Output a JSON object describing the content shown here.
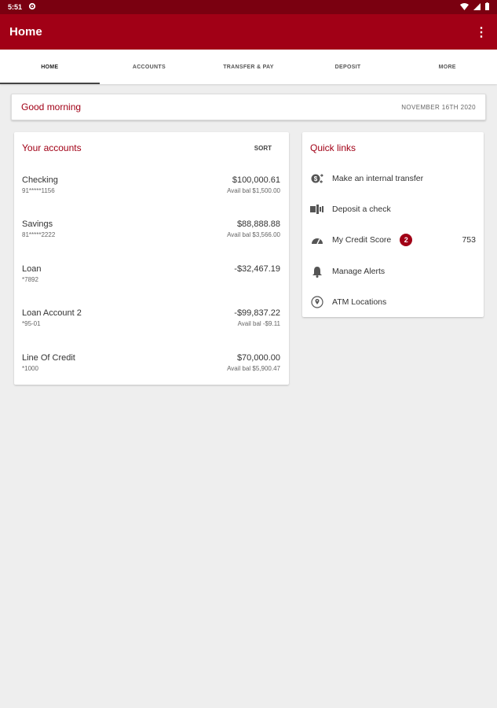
{
  "status": {
    "time": "5:51"
  },
  "appbar": {
    "title": "Home",
    "menu": "⋮"
  },
  "tabs": [
    {
      "label": "HOME",
      "active": true
    },
    {
      "label": "ACCOUNTS"
    },
    {
      "label": "TRANSFER & PAY"
    },
    {
      "label": "DEPOSIT"
    },
    {
      "label": "MORE"
    }
  ],
  "greeting": {
    "text": "Good morning",
    "date": "NOVEMBER 16TH 2020"
  },
  "accounts": {
    "title": "Your accounts",
    "sort_label": "SORT",
    "items": [
      {
        "name": "Checking",
        "number": "91*****1156",
        "balance": "$100,000.61",
        "avail": "Avail bal $1,500.00"
      },
      {
        "name": "Savings",
        "number": "81*****2222",
        "balance": "$88,888.88",
        "avail": "Avail bal $3,566.00"
      },
      {
        "name": "Loan",
        "number": "*7892",
        "balance": "-$32,467.19",
        "avail": ""
      },
      {
        "name": "Loan Account 2",
        "number": "*95-01",
        "balance": "-$99,837.22",
        "avail": "Avail bal -$9.11"
      },
      {
        "name": "Line Of Credit",
        "number": "*1000",
        "balance": "$70,000.00",
        "avail": "Avail bal $5,900.47"
      }
    ]
  },
  "quick_links": {
    "title": "Quick links",
    "items": [
      {
        "label": "Make an internal transfer",
        "icon": "transfer-icon"
      },
      {
        "label": "Deposit a check",
        "icon": "check-deposit-icon"
      },
      {
        "label": "My Credit Score",
        "icon": "gauge-icon",
        "badge": "2",
        "score": "753"
      },
      {
        "label": "Manage Alerts",
        "icon": "bell-icon"
      },
      {
        "label": "ATM Locations",
        "icon": "location-pin-icon"
      }
    ]
  },
  "colors": {
    "brand": "#a10016",
    "status": "#7a0010",
    "background": "#eeeeee"
  }
}
